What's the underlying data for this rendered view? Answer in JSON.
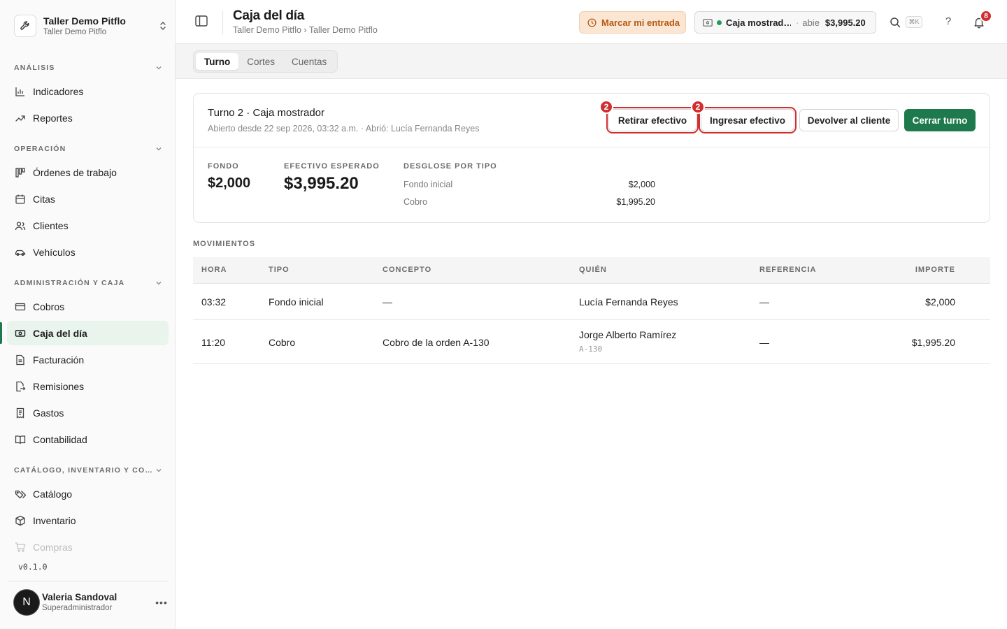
{
  "org": {
    "name": "Taller Demo Pitflo",
    "subtitle": "Taller Demo Pitflo"
  },
  "sidebar": {
    "sections": [
      {
        "title": "ANÁLISIS",
        "items": [
          "Indicadores",
          "Reportes"
        ]
      },
      {
        "title": "OPERACIÓN",
        "items": [
          "Órdenes de trabajo",
          "Citas",
          "Clientes",
          "Vehículos"
        ]
      },
      {
        "title": "ADMINISTRACIÓN Y CAJA",
        "items": [
          "Cobros",
          "Caja del día",
          "Facturación",
          "Remisiones",
          "Gastos",
          "Contabilidad"
        ]
      },
      {
        "title": "CATÁLOGO, INVENTARIO Y CO…",
        "items": [
          "Catálogo",
          "Inventario",
          "Compras"
        ]
      }
    ],
    "active_item": "Caja del día",
    "version": "v0.1.0"
  },
  "user": {
    "initial": "N",
    "name": "Valeria Sandoval",
    "role": "Superadministrador"
  },
  "header": {
    "title": "Caja del día",
    "breadcrumb": "Taller Demo Pitflo › Taller Demo Pitflo",
    "clock_in_label": "Marcar mi entrada",
    "cashbox": {
      "name": "Caja mostrad…",
      "separator": "·",
      "state": "abie",
      "amount": "$3,995.20"
    },
    "shortcut": "⌘K",
    "help": "?",
    "notifications_count": "8"
  },
  "tabs": [
    "Turno",
    "Cortes",
    "Cuentas"
  ],
  "active_tab": "Turno",
  "shift": {
    "title": "Turno 2 · Caja mostrador",
    "subtitle": "Abierto desde 22 sep 2026, 03:32 a.m. · Abrió: Lucía Fernanda Reyes",
    "buttons": {
      "withdraw": "Retirar efectivo",
      "deposit": "Ingresar efectivo",
      "refund": "Devolver al cliente",
      "close": "Cerrar turno"
    },
    "highlight_badges": {
      "withdraw": "2",
      "deposit": "2"
    },
    "fondo_label": "FONDO",
    "fondo_value": "$2,000",
    "expected_label": "EFECTIVO ESPERADO",
    "expected_value": "$3,995.20",
    "breakdown_label": "DESGLOSE POR TIPO",
    "breakdown": [
      {
        "label": "Fondo inicial",
        "value": "$2,000"
      },
      {
        "label": "Cobro",
        "value": "$1,995.20"
      }
    ]
  },
  "movements": {
    "title": "MOVIMIENTOS",
    "columns": [
      "HORA",
      "TIPO",
      "CONCEPTO",
      "QUIÉN",
      "REFERENCIA",
      "IMPORTE"
    ],
    "rows": [
      {
        "hora": "03:32",
        "tipo": "Fondo inicial",
        "concepto": "—",
        "quien": "Lucía Fernanda Reyes",
        "quien_sub": "",
        "referencia": "—",
        "importe": "$2,000"
      },
      {
        "hora": "11:20",
        "tipo": "Cobro",
        "concepto": "Cobro de la orden A-130",
        "quien": "Jorge Alberto Ramírez",
        "quien_sub": "A-130",
        "referencia": "—",
        "importe": "$1,995.20"
      }
    ]
  },
  "colors": {
    "accent": "#1e7a4c",
    "highlight": "#d12f2f",
    "warning_bg": "#fbe6d3",
    "warning_text": "#b45a14"
  }
}
